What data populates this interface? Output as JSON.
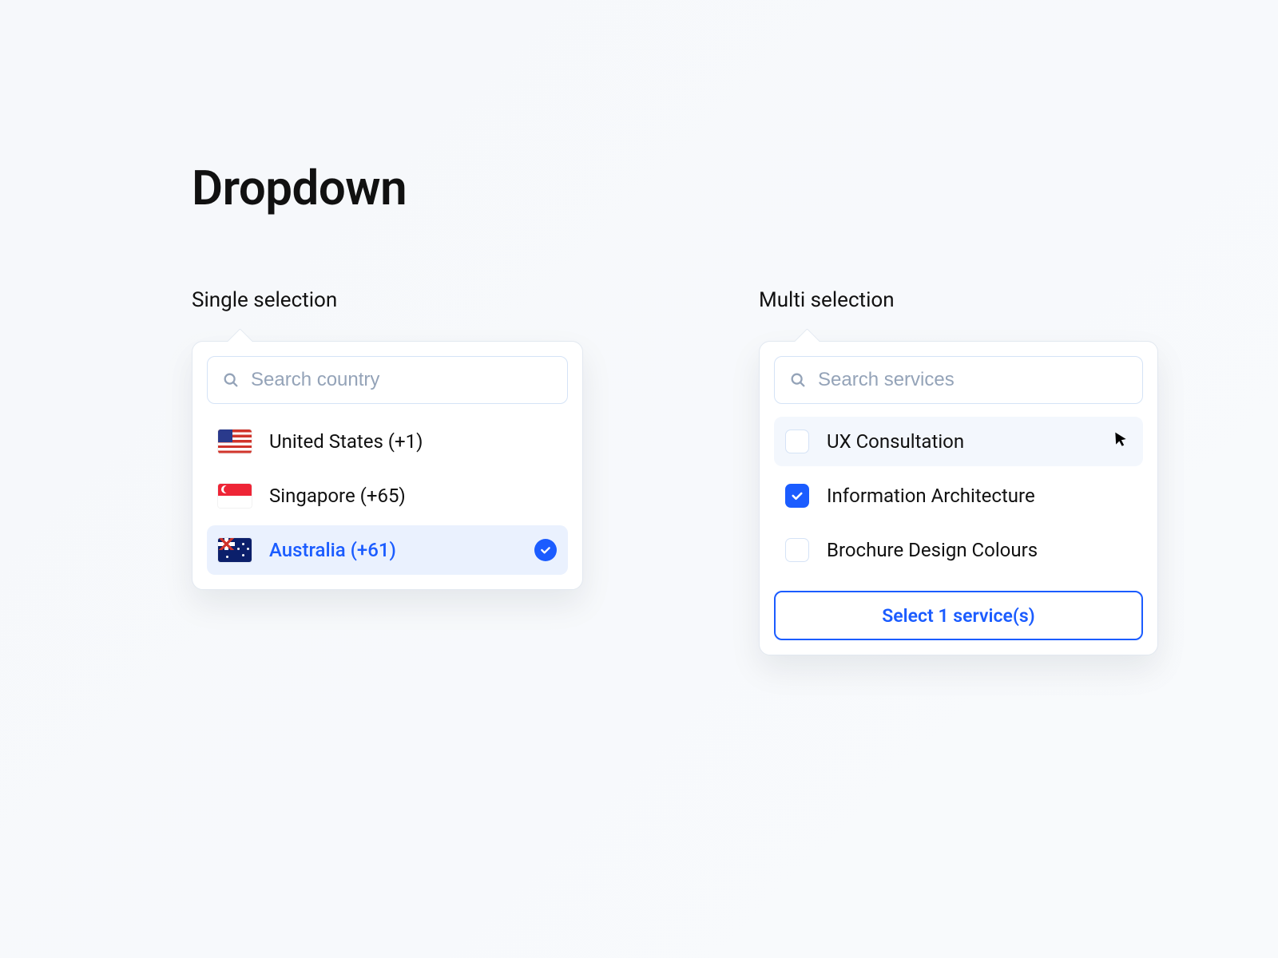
{
  "title": "Dropdown",
  "single": {
    "label": "Single selection",
    "search_placeholder": "Search country",
    "options": [
      {
        "flag": "us",
        "label": "United States (+1)",
        "selected": false
      },
      {
        "flag": "sg",
        "label": "Singapore (+65)",
        "selected": false
      },
      {
        "flag": "au",
        "label": "Australia (+61)",
        "selected": true
      }
    ]
  },
  "multi": {
    "label": "Multi selection",
    "search_placeholder": "Search services",
    "options": [
      {
        "label": "UX Consultation",
        "checked": false,
        "hover": true
      },
      {
        "label": "Information Architecture",
        "checked": true,
        "hover": false
      },
      {
        "label": "Brochure Design Colours",
        "checked": false,
        "hover": false
      }
    ],
    "action_label": "Select 1 service(s)"
  },
  "colors": {
    "accent": "#1b5cff"
  }
}
